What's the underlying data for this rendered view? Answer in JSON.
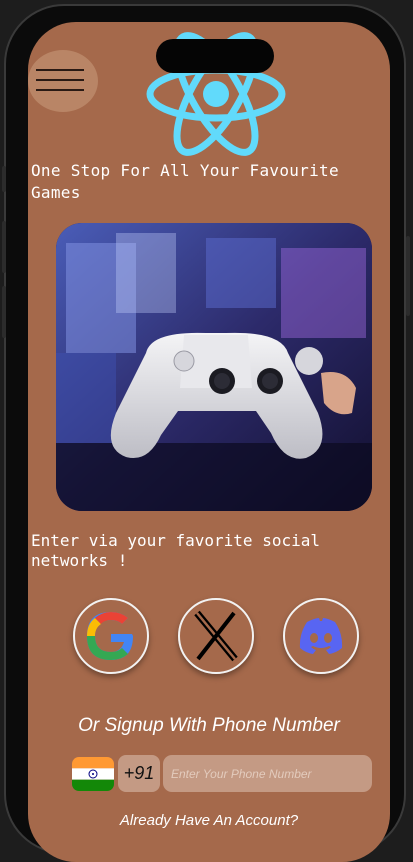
{
  "tagline": "One Stop For All Your Favourite Games",
  "social_prompt": "Enter via your favorite social networks !",
  "social_buttons": [
    {
      "name": "google",
      "icon": "google-icon"
    },
    {
      "name": "x",
      "icon": "x-icon"
    },
    {
      "name": "discord",
      "icon": "discord-icon"
    }
  ],
  "phone_signup": {
    "heading": "Or Signup With Phone Number",
    "country_code": "+91",
    "country_flag": "india-flag-icon",
    "placeholder": "Enter Your Phone Number"
  },
  "footer_link": "Already Have An Account?",
  "colors": {
    "background": "#a5694b",
    "react_logo": "#61dafb",
    "input_bg": "#c49a84"
  }
}
